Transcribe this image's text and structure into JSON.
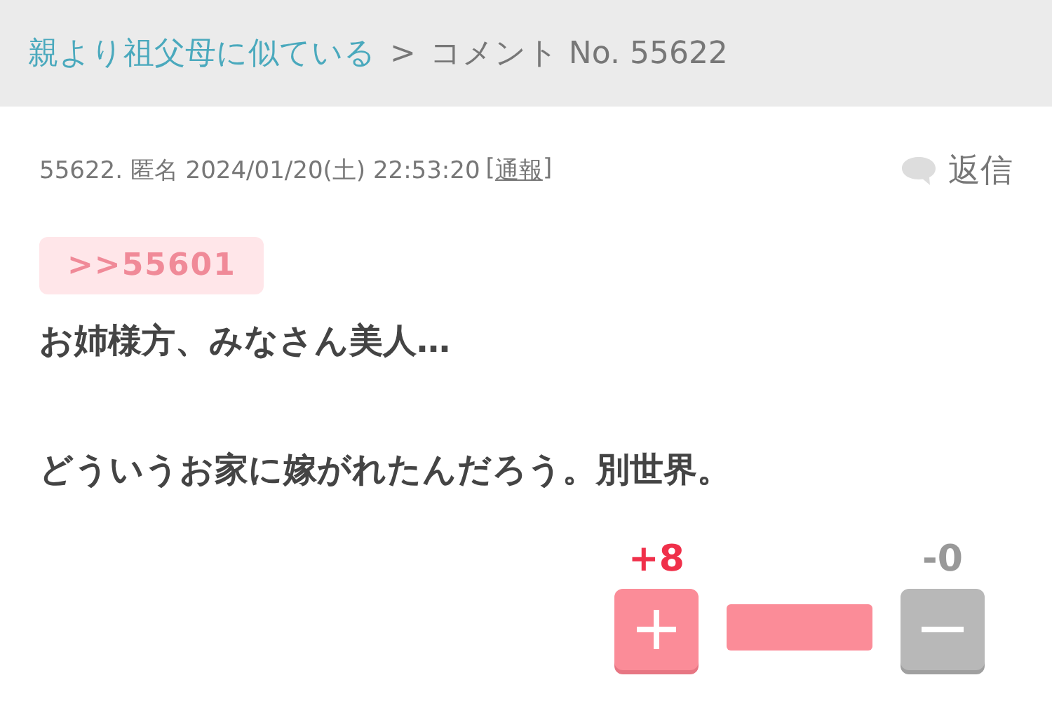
{
  "breadcrumb": {
    "topic": "親より祖父母に似ている",
    "separator": ">",
    "current": "コメント No. 55622"
  },
  "comment": {
    "meta": "55622. 匿名 2024/01/20(土) 22:53:20",
    "report_open": "[",
    "report_link": "通報",
    "report_close": "]",
    "reply": "返信",
    "anchor": ">>55601",
    "body": "お姉様方、みなさん美人…\n\nどういうお家に嫁がれたんだろう。別世界。"
  },
  "votes": {
    "plus": "+8",
    "minus": "-0",
    "level": 1
  }
}
